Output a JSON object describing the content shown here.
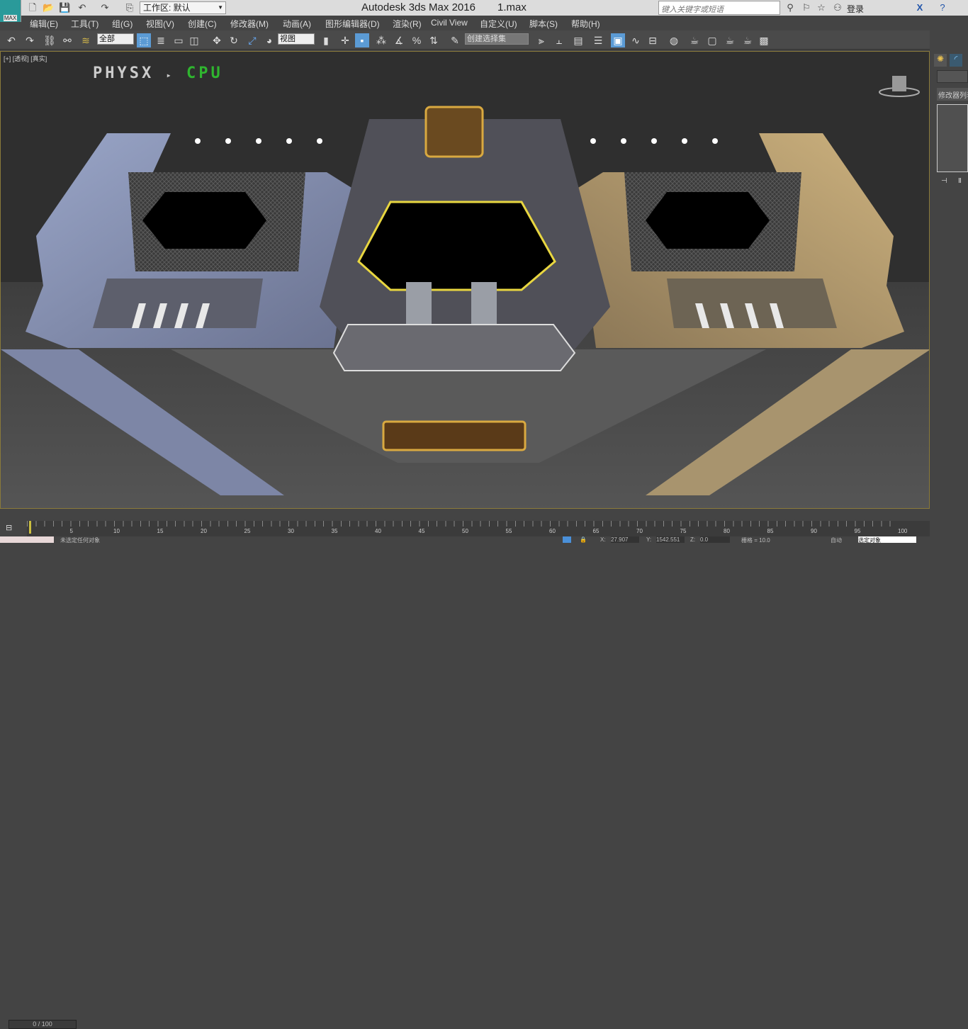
{
  "app": {
    "title": "Autodesk 3ds Max 2016",
    "file": "1.max",
    "logo_label": "MAX",
    "workspace": "工作区: 默认",
    "search_placeholder": "键入关键字或短语",
    "login": "登录"
  },
  "menu": [
    "编辑(E)",
    "工具(T)",
    "组(G)",
    "视图(V)",
    "创建(C)",
    "修改器(M)",
    "动画(A)",
    "图形编辑器(D)",
    "渲染(R)",
    "Civil View",
    "自定义(U)",
    "脚本(S)",
    "帮助(H)"
  ],
  "toolbar": {
    "selection_filter": "全部",
    "reference_coord": "视图",
    "named_selection": "创建选择集"
  },
  "viewport": {
    "label": "[+] [透视] [真实]",
    "physx": "PHYSX",
    "physx_mode": "CPU",
    "accent": "#e8d640"
  },
  "command_panel": {
    "modifier_list": "修改器列表"
  },
  "timeline": {
    "frame": "0 / 100",
    "ticks": [
      5,
      10,
      15,
      20,
      25,
      30,
      35,
      40,
      45,
      50,
      55,
      60,
      65,
      70,
      75,
      80,
      85,
      90,
      95,
      100
    ]
  },
  "status": {
    "message": "未选定任何对象",
    "x_label": "X:",
    "x": "27.907",
    "y_label": "Y:",
    "y": "1542.551",
    "z_label": "Z:",
    "z": "0.0",
    "grid": "栅格 = 10.0",
    "auto_key": "自动",
    "key_filter": "选定对象"
  }
}
